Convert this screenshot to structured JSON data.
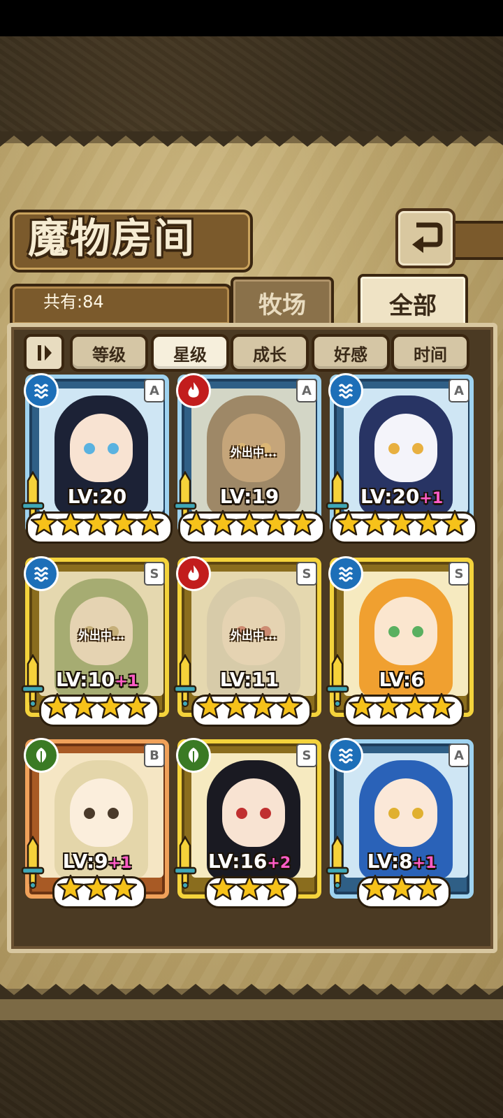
{
  "title": "魔物房间",
  "count_label": "共有:84",
  "tabs": {
    "farm": "牧场",
    "all": "全部"
  },
  "sort_buttons": [
    "等级",
    "星级",
    "成长",
    "好感",
    "时间"
  ],
  "active_sort": "星级",
  "away_label": "外出中...",
  "monsters": [
    {
      "element": "water",
      "rank": "A",
      "level": "LV:20",
      "bonus": "",
      "stars": 5,
      "away": false,
      "frame": "A",
      "hair": "#1c2236",
      "skin": "#f8e3d2",
      "eye": "#5ab2e0"
    },
    {
      "element": "fire",
      "rank": "A",
      "level": "LV:19",
      "bonus": "",
      "stars": 5,
      "away": true,
      "frame": "A",
      "hair": "#5a3a22",
      "skin": "#b07a4c",
      "eye": "#e0a040"
    },
    {
      "element": "water",
      "rank": "A",
      "level": "LV:20",
      "bonus": "+1",
      "stars": 5,
      "away": false,
      "frame": "A",
      "hair": "#283464",
      "skin": "#f4f4fa",
      "eye": "#e8b040"
    },
    {
      "element": "water",
      "rank": "S",
      "level": "LV:10",
      "bonus": "+1",
      "stars": 4,
      "away": true,
      "frame": "S",
      "hair": "#6a8a3a",
      "skin": "#f5e0c8",
      "eye": "#b0904a"
    },
    {
      "element": "fire",
      "rank": "S",
      "level": "LV:11",
      "bonus": "",
      "stars": 4,
      "away": true,
      "frame": "S",
      "hair": "#d8cfb4",
      "skin": "#f5e0c8",
      "eye": "#c0403a"
    },
    {
      "element": "water",
      "rank": "S",
      "level": "LV:6",
      "bonus": "",
      "stars": 4,
      "away": false,
      "frame": "S",
      "hair": "#f0a030",
      "skin": "#fbe6cf",
      "eye": "#5ab060"
    },
    {
      "element": "wood",
      "rank": "B",
      "level": "LV:9",
      "bonus": "+1",
      "stars": 3,
      "away": false,
      "frame": "B",
      "hair": "#e4d6aa",
      "skin": "#fbeedc",
      "eye": "#4a3a2a"
    },
    {
      "element": "wood",
      "rank": "S",
      "level": "LV:16",
      "bonus": "+2",
      "stars": 3,
      "away": false,
      "frame": "S",
      "hair": "#1a1a22",
      "skin": "#f8e3d2",
      "eye": "#c03030"
    },
    {
      "element": "water",
      "rank": "A",
      "level": "LV:8",
      "bonus": "+1",
      "stars": 3,
      "away": false,
      "frame": "A",
      "hair": "#2a62b8",
      "skin": "#fbe8d8",
      "eye": "#e0b030"
    }
  ]
}
